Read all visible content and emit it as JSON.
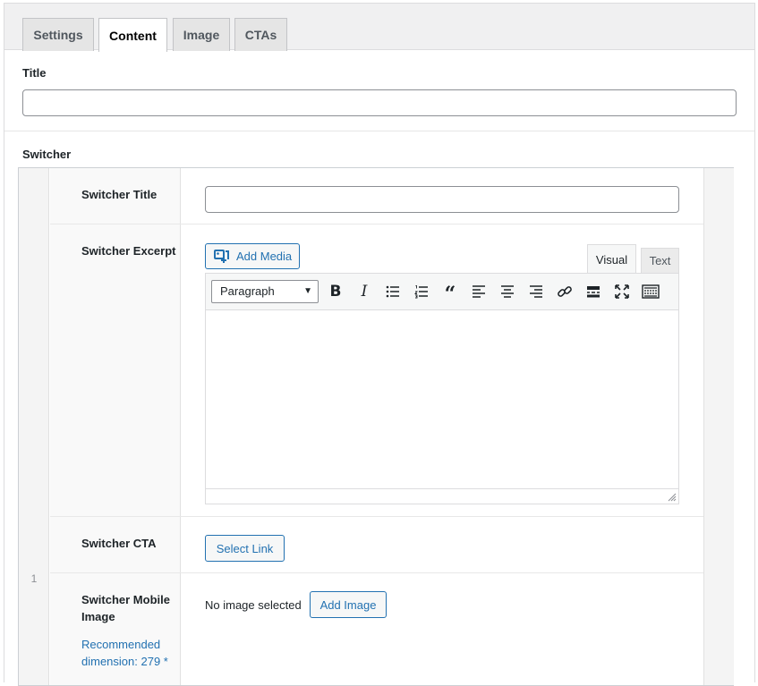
{
  "tabs": [
    {
      "label": "Settings",
      "active": false
    },
    {
      "label": "Content",
      "active": true
    },
    {
      "label": "Image",
      "active": false
    },
    {
      "label": "CTAs",
      "active": false
    }
  ],
  "title_field": {
    "label": "Title",
    "value": ""
  },
  "switcher": {
    "label": "Switcher",
    "row_number": "1",
    "switcher_title": {
      "label": "Switcher Title",
      "value": ""
    },
    "switcher_excerpt": {
      "label": "Switcher Excerpt",
      "add_media_label": "Add Media",
      "visual_tab": "Visual",
      "text_tab": "Text",
      "format_value": "Paragraph",
      "toolbar_icons": [
        "bold-icon",
        "italic-icon",
        "bullet-list-icon",
        "numbered-list-icon",
        "blockquote-icon",
        "align-left-icon",
        "align-center-icon",
        "align-right-icon",
        "link-icon",
        "read-more-icon",
        "fullscreen-icon",
        "toolbar-toggle-icon"
      ]
    },
    "switcher_cta": {
      "label": "Switcher CTA",
      "button_label": "Select Link"
    },
    "switcher_mobile_image": {
      "label_line1": "Switcher Mobile",
      "label_line2": "Image",
      "no_image_text": "No image selected",
      "add_image_label": "Add Image",
      "recommendation_line1": "Recommended",
      "recommendation_line2": "dimension: 279 *"
    }
  },
  "colors": {
    "accent": "#2271b1",
    "border": "#8c8f94"
  }
}
